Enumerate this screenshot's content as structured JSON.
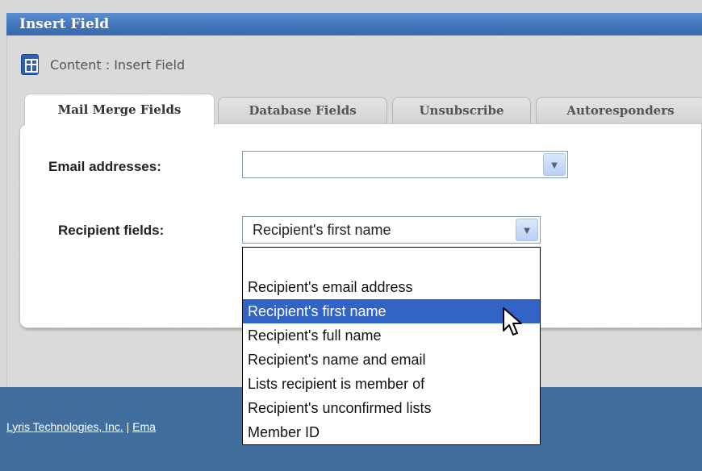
{
  "window": {
    "title": "Insert Field"
  },
  "breadcrumb": {
    "text": "Content : Insert Field"
  },
  "tabs": [
    {
      "label": "Mail Merge Fields",
      "active": true
    },
    {
      "label": "Database Fields",
      "active": false
    },
    {
      "label": "Unsubscribe",
      "active": false
    },
    {
      "label": "Autoresponders",
      "active": false
    }
  ],
  "form": {
    "email_label": "Email addresses:",
    "email_value": "",
    "recipient_label": "Recipient fields:",
    "recipient_value": "Recipient's first name"
  },
  "dropdown": {
    "options": [
      "Recipient's email address",
      "Recipient's first name",
      "Recipient's full name",
      "Recipient's name and email",
      "Lists recipient is member of",
      "Recipient's unconfirmed lists",
      "Member ID"
    ],
    "highlighted": "Recipient's first name"
  },
  "footer": {
    "company_link": "Lyris Technologies, Inc.",
    "separator": " | ",
    "partial_link": "Ema"
  },
  "colors": {
    "titlebar": "#3f72b8",
    "footer": "#426e9e",
    "highlight": "#3264c8"
  }
}
